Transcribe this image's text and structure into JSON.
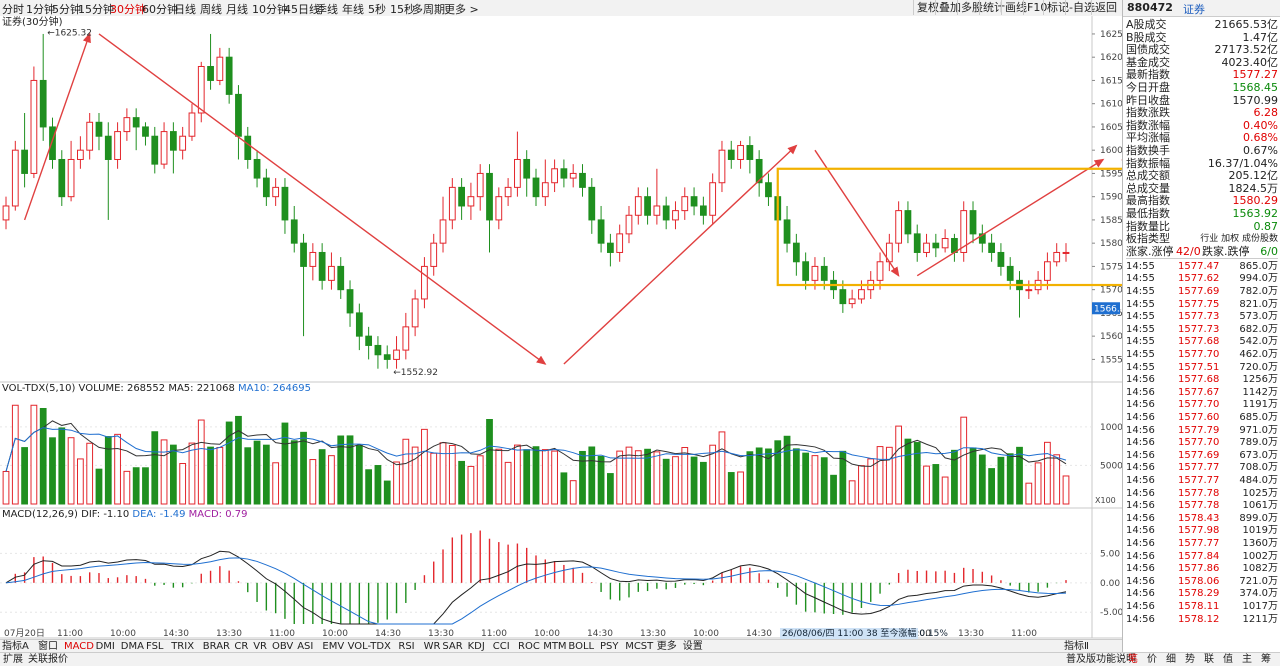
{
  "periods": [
    "分时",
    "1分钟",
    "5分钟",
    "15分钟",
    "30分钟",
    "60分钟",
    "日线",
    "周线",
    "月线",
    "10分钟",
    "45日线",
    "季线",
    "年线",
    "5秒",
    "15秒",
    "多周期",
    "更多 >"
  ],
  "active_period": "30分钟",
  "toolbar": [
    "复权",
    "叠加",
    "多股",
    "统计",
    "画线",
    "F10",
    "标记",
    "-自选",
    "返回"
  ],
  "main_label": "证券(30分钟)",
  "vol_label": {
    "name": "VOL-TDX(5,10)",
    "vol": "VOLUME: 268552",
    "ma5": "MA5: 221068",
    "ma10": "MA10: 264695",
    "x100": "X100"
  },
  "macd_label": {
    "name": "MACD(12,26,9)",
    "dif": "DIF: -1.10",
    "dea": "DEA: -1.49",
    "macd": "MACD: 0.79"
  },
  "hi_label": "1625.32",
  "lo_label": "1552.92",
  "cursor_price": "1566.0",
  "time_axis": [
    "07月20日",
    "11:00",
    "10:00",
    "14:30",
    "13:30",
    "11:00",
    "10:00",
    "14:30",
    "13:30",
    "11:00",
    "10:00",
    "14:30",
    "13:30",
    "10:00",
    "14:30",
    "13:30",
    "11:00",
    "10:00",
    "13:30",
    "11:00"
  ],
  "status_tip": "26/08/06/四 11:00 38 至今涨幅 0.15%",
  "indicators": [
    "指标A",
    "窗口",
    "MACD",
    "DMI",
    "DMA",
    "FSL",
    "TRIX",
    "BRAR",
    "CR",
    "VR",
    "OBV",
    "ASI",
    "EMV",
    "VOL-TDX",
    "RSI",
    "WR",
    "SAR",
    "KDJ",
    "CCI",
    "ROC",
    "MTM",
    "BOLL",
    "PSY",
    "MCST",
    "更多",
    "设置"
  ],
  "active_indicator": "MACD",
  "ind_right": "指标Ⅱ",
  "bottom_left": [
    "扩展",
    "关联报价"
  ],
  "bottom_right": {
    "help": "普及版功能说明",
    "tabs": [
      "笔",
      "价",
      "细",
      "势",
      "联",
      "值",
      "主",
      "筹"
    ]
  },
  "right_panel": {
    "code": "880472",
    "name": "证券",
    "rows": [
      {
        "k": "A股成交",
        "v": "21665.53亿",
        "c": "black"
      },
      {
        "k": "B股成交",
        "v": "1.47亿",
        "c": "black"
      },
      {
        "k": "国债成交",
        "v": "27173.52亿",
        "c": "black"
      },
      {
        "k": "基金成交",
        "v": "4023.40亿",
        "c": "black"
      },
      {
        "k": "最新指数",
        "v": "1577.27",
        "c": "red"
      },
      {
        "k": "今日开盘",
        "v": "1568.45",
        "c": "green"
      },
      {
        "k": "昨日收盘",
        "v": "1570.99",
        "c": "black"
      },
      {
        "k": "指数涨跌",
        "v": "6.28",
        "c": "red"
      },
      {
        "k": "指数涨幅",
        "v": "0.40%",
        "c": "red"
      },
      {
        "k": "平均涨幅",
        "v": "0.68%",
        "c": "red"
      },
      {
        "k": "指数换手",
        "v": "0.67%",
        "c": "black"
      },
      {
        "k": "指数振幅",
        "v": "16.37/1.04%",
        "c": "black"
      },
      {
        "k": "总成交额",
        "v": "205.12亿",
        "c": "black"
      },
      {
        "k": "总成交量",
        "v": "1824.5万",
        "c": "black"
      },
      {
        "k": "最高指数",
        "v": "1580.29",
        "c": "red"
      },
      {
        "k": "最低指数",
        "v": "1563.92",
        "c": "green"
      },
      {
        "k": "指数量比",
        "v": "0.87",
        "c": "green"
      }
    ],
    "board_type": {
      "k": "板指类型",
      "v": "行业 加权 成份股数"
    },
    "up_down": {
      "k1": "涨家.涨停",
      "v1": "42/0",
      "k2": "跌家.跌停",
      "v2": "6/0"
    },
    "ticks": [
      [
        "14:55",
        "1577.47",
        "865.0万"
      ],
      [
        "14:55",
        "1577.62",
        "994.0万"
      ],
      [
        "14:55",
        "1577.69",
        "782.0万"
      ],
      [
        "14:55",
        "1577.75",
        "821.0万"
      ],
      [
        "14:55",
        "1577.73",
        "573.0万"
      ],
      [
        "14:55",
        "1577.73",
        "682.0万"
      ],
      [
        "14:55",
        "1577.68",
        "542.0万"
      ],
      [
        "14:55",
        "1577.70",
        "462.0万"
      ],
      [
        "14:55",
        "1577.51",
        "720.0万"
      ],
      [
        "14:56",
        "1577.68",
        "1256万"
      ],
      [
        "14:56",
        "1577.67",
        "1142万"
      ],
      [
        "14:56",
        "1577.70",
        "1191万"
      ],
      [
        "14:56",
        "1577.60",
        "685.0万"
      ],
      [
        "14:56",
        "1577.79",
        "971.0万"
      ],
      [
        "14:56",
        "1577.70",
        "789.0万"
      ],
      [
        "14:56",
        "1577.69",
        "673.0万"
      ],
      [
        "14:56",
        "1577.77",
        "708.0万"
      ],
      [
        "14:56",
        "1577.77",
        "484.0万"
      ],
      [
        "14:56",
        "1577.78",
        "1025万"
      ],
      [
        "14:56",
        "1577.78",
        "1061万"
      ],
      [
        "14:56",
        "1578.43",
        "899.0万"
      ],
      [
        "14:56",
        "1577.98",
        "1019万"
      ],
      [
        "14:56",
        "1577.77",
        "1360万"
      ],
      [
        "14:56",
        "1577.84",
        "1002万"
      ],
      [
        "14:56",
        "1577.86",
        "1082万"
      ],
      [
        "14:56",
        "1578.06",
        "721.0万"
      ],
      [
        "14:56",
        "1578.29",
        "374.0万"
      ],
      [
        "14:56",
        "1578.11",
        "1017万"
      ],
      [
        "14:56",
        "1578.12",
        "1211万"
      ]
    ]
  },
  "chart_data": {
    "type": "candlestick",
    "price_axis": {
      "ticks": [
        1555,
        1560,
        1565,
        1570,
        1575,
        1580,
        1585,
        1590,
        1595,
        1600,
        1605,
        1610,
        1615,
        1620,
        1625
      ],
      "ylim": [
        1551,
        1628
      ]
    },
    "volume_axis": {
      "ticks": [
        5000,
        10000
      ],
      "ylim": [
        0,
        14000
      ]
    },
    "macd_axis": {
      "ticks": [
        -5.0,
        0.0,
        5.0
      ],
      "ylim": [
        -7,
        10
      ]
    },
    "candles": [
      [
        1585,
        1588,
        1583,
        1590
      ],
      [
        1588,
        1600,
        1587,
        1602
      ],
      [
        1600,
        1595,
        1592,
        1608
      ],
      [
        1595,
        1615,
        1594,
        1618
      ],
      [
        1615,
        1605,
        1602,
        1625
      ],
      [
        1605,
        1598,
        1596,
        1607
      ],
      [
        1598,
        1590,
        1588,
        1600
      ],
      [
        1590,
        1598,
        1589,
        1602
      ],
      [
        1598,
        1600,
        1596,
        1603
      ],
      [
        1600,
        1606,
        1598,
        1608
      ],
      [
        1606,
        1603,
        1600,
        1608
      ],
      [
        1603,
        1598,
        1585,
        1606
      ],
      [
        1598,
        1604,
        1596,
        1606
      ],
      [
        1604,
        1607,
        1602,
        1609
      ],
      [
        1607,
        1605,
        1600,
        1609
      ],
      [
        1605,
        1603,
        1601,
        1606
      ],
      [
        1603,
        1597,
        1595,
        1605
      ],
      [
        1597,
        1604,
        1596,
        1606
      ],
      [
        1604,
        1600,
        1595,
        1606
      ],
      [
        1600,
        1603,
        1598,
        1605
      ],
      [
        1603,
        1608,
        1602,
        1610
      ],
      [
        1608,
        1618,
        1606,
        1619
      ],
      [
        1618,
        1615,
        1613,
        1625
      ],
      [
        1615,
        1620,
        1614,
        1622
      ],
      [
        1620,
        1612,
        1610,
        1622
      ],
      [
        1612,
        1603,
        1598,
        1614
      ],
      [
        1603,
        1598,
        1596,
        1605
      ],
      [
        1598,
        1594,
        1592,
        1600
      ],
      [
        1594,
        1590,
        1588,
        1596
      ],
      [
        1590,
        1592,
        1588,
        1594
      ],
      [
        1592,
        1585,
        1582,
        1594
      ],
      [
        1585,
        1580,
        1578,
        1588
      ],
      [
        1580,
        1575,
        1560,
        1582
      ],
      [
        1575,
        1578,
        1572,
        1580
      ],
      [
        1578,
        1572,
        1570,
        1580
      ],
      [
        1572,
        1575,
        1570,
        1578
      ],
      [
        1575,
        1570,
        1568,
        1577
      ],
      [
        1570,
        1565,
        1562,
        1572
      ],
      [
        1565,
        1560,
        1557,
        1567
      ],
      [
        1560,
        1558,
        1555,
        1562
      ],
      [
        1558,
        1556,
        1553,
        1560
      ],
      [
        1556,
        1555,
        1553,
        1558
      ],
      [
        1555,
        1557,
        1553,
        1560
      ],
      [
        1557,
        1562,
        1555,
        1565
      ],
      [
        1562,
        1568,
        1560,
        1570
      ],
      [
        1568,
        1575,
        1566,
        1577
      ],
      [
        1575,
        1580,
        1573,
        1582
      ],
      [
        1580,
        1585,
        1578,
        1590
      ],
      [
        1585,
        1592,
        1583,
        1594
      ],
      [
        1592,
        1588,
        1585,
        1594
      ],
      [
        1588,
        1590,
        1585,
        1593
      ],
      [
        1590,
        1595,
        1587,
        1597
      ],
      [
        1595,
        1585,
        1578,
        1597
      ],
      [
        1585,
        1590,
        1583,
        1592
      ],
      [
        1590,
        1592,
        1588,
        1594
      ],
      [
        1592,
        1598,
        1590,
        1604
      ],
      [
        1598,
        1594,
        1590,
        1600
      ],
      [
        1594,
        1590,
        1588,
        1596
      ],
      [
        1590,
        1593,
        1588,
        1598
      ],
      [
        1593,
        1596,
        1591,
        1598
      ],
      [
        1596,
        1594,
        1592,
        1598
      ],
      [
        1594,
        1595,
        1592,
        1597
      ],
      [
        1595,
        1592,
        1590,
        1597
      ],
      [
        1592,
        1585,
        1582,
        1594
      ],
      [
        1585,
        1580,
        1578,
        1588
      ],
      [
        1580,
        1578,
        1575,
        1582
      ],
      [
        1578,
        1582,
        1576,
        1584
      ],
      [
        1582,
        1586,
        1580,
        1588
      ],
      [
        1586,
        1590,
        1584,
        1592
      ],
      [
        1590,
        1586,
        1584,
        1592
      ],
      [
        1586,
        1588,
        1584,
        1596
      ],
      [
        1588,
        1585,
        1583,
        1590
      ],
      [
        1585,
        1587,
        1583,
        1589
      ],
      [
        1587,
        1590,
        1585,
        1592
      ],
      [
        1590,
        1588,
        1586,
        1592
      ],
      [
        1588,
        1586,
        1584,
        1590
      ],
      [
        1586,
        1593,
        1584,
        1595
      ],
      [
        1593,
        1600,
        1591,
        1602
      ],
      [
        1600,
        1598,
        1596,
        1602
      ],
      [
        1598,
        1601,
        1596,
        1602
      ],
      [
        1601,
        1598,
        1595,
        1603
      ],
      [
        1598,
        1593,
        1590,
        1600
      ],
      [
        1593,
        1590,
        1588,
        1595
      ],
      [
        1590,
        1585,
        1582,
        1592
      ],
      [
        1585,
        1580,
        1578,
        1588
      ],
      [
        1580,
        1576,
        1573,
        1582
      ],
      [
        1576,
        1572,
        1570,
        1578
      ],
      [
        1572,
        1575,
        1570,
        1577
      ],
      [
        1575,
        1572,
        1570,
        1577
      ],
      [
        1572,
        1570,
        1568,
        1574
      ],
      [
        1570,
        1567,
        1565,
        1572
      ],
      [
        1567,
        1568,
        1566,
        1570
      ],
      [
        1568,
        1570,
        1567,
        1572
      ],
      [
        1570,
        1572,
        1568,
        1574
      ],
      [
        1572,
        1576,
        1570,
        1578
      ],
      [
        1576,
        1580,
        1574,
        1582
      ],
      [
        1580,
        1587,
        1578,
        1589
      ],
      [
        1587,
        1582,
        1580,
        1589
      ],
      [
        1582,
        1578,
        1576,
        1584
      ],
      [
        1578,
        1580,
        1577,
        1582
      ],
      [
        1580,
        1579,
        1577,
        1582
      ],
      [
        1579,
        1581,
        1578,
        1583
      ],
      [
        1581,
        1578,
        1576,
        1582
      ],
      [
        1578,
        1587,
        1576,
        1589
      ],
      [
        1587,
        1582,
        1580,
        1589
      ],
      [
        1582,
        1580,
        1578,
        1584
      ],
      [
        1580,
        1578,
        1576,
        1582
      ],
      [
        1578,
        1575,
        1573,
        1580
      ],
      [
        1575,
        1572,
        1570,
        1577
      ],
      [
        1572,
        1570,
        1564,
        1574
      ],
      [
        1570,
        1570,
        1568,
        1572
      ],
      [
        1570,
        1572,
        1569,
        1574
      ],
      [
        1572,
        1576,
        1570,
        1578
      ],
      [
        1576,
        1578,
        1575,
        1580
      ],
      [
        1578,
        1578,
        1576,
        1580
      ]
    ],
    "annotations": [
      "1625.32",
      "1552.92"
    ]
  }
}
